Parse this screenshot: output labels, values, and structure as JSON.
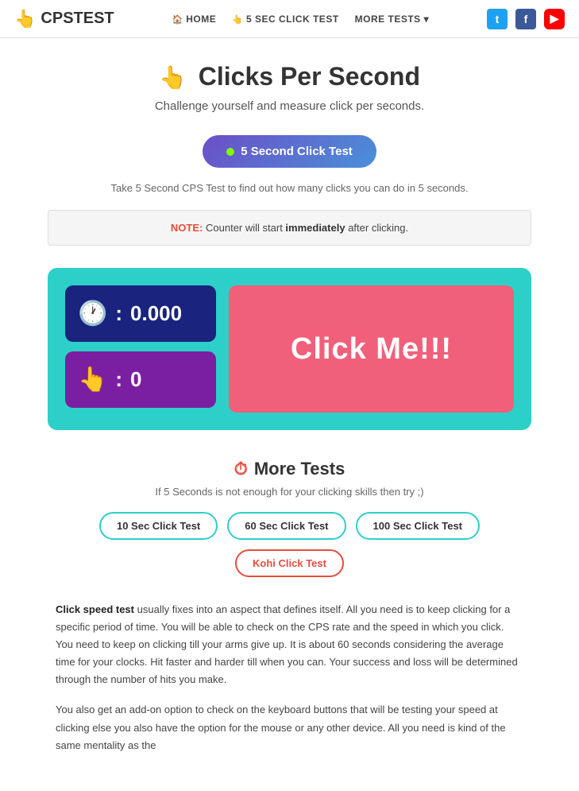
{
  "brand": {
    "icon": "👆",
    "name": "CPSTEST"
  },
  "nav": {
    "home": "HOME",
    "clickTest": "5 SEC CLICK TEST",
    "moreTests": "MORE TESTS"
  },
  "social": {
    "twitter": "t",
    "facebook": "f",
    "youtube": "▶"
  },
  "hero": {
    "icon": "👆",
    "title": "Clicks Per Second",
    "subtitle": "Challenge yourself and measure click per seconds.",
    "ctaLabel": "5 Second Click Test",
    "ctaDesc": "Take 5 Second CPS Test to find out how many clicks you can do in 5 seconds.",
    "noteLabel": "NOTE:",
    "noteText": " Counter will start ",
    "noteImmediate": "immediately",
    "noteAfter": " after clicking."
  },
  "counter": {
    "timerIcon": "🕐",
    "timerValue": "0.000",
    "clickIcon": "👆",
    "clickValue": "0",
    "clickMeLabel": "Click Me!!!"
  },
  "moreTests": {
    "icon": "⏱",
    "title": "More Tests",
    "subtitle": "If 5 Seconds is not enough for your clicking skills then try ;)",
    "tests": [
      {
        "label": "10 Sec Click Test",
        "highlight": false
      },
      {
        "label": "60 Sec Click Test",
        "highlight": false
      },
      {
        "label": "100 Sec Click Test",
        "highlight": false
      },
      {
        "label": "Kohi Click Test",
        "highlight": true
      }
    ]
  },
  "article": {
    "para1Bold": "Click speed test",
    "para1Rest": " usually fixes into an aspect that defines itself. All you need is to keep clicking for a specific period of time. You will be able to check on the CPS rate and the speed in which you click. You need to keep on clicking till your arms give up. It is about 60 seconds considering the average time for your clocks. Hit faster and harder till when you can. Your success and loss will be determined through the number of hits you make.",
    "para2": "You also get an add-on option to check on the keyboard buttons that will be testing your speed at clicking else you also have the option for the mouse or any other device. All you need is kind of the same mentality as the"
  }
}
